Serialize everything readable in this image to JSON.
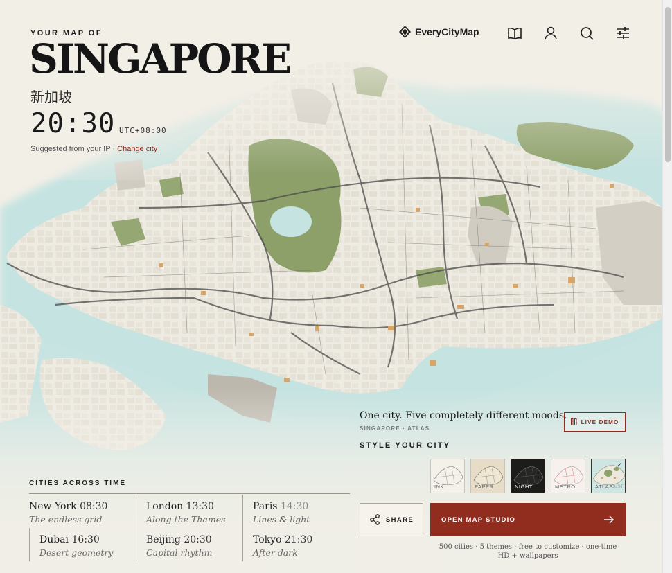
{
  "hero": {
    "eyebrow": "YOUR MAP OF",
    "city": "SINGAPORE",
    "native_name": "新加坡",
    "local_time": "20:30",
    "timezone": "UTC+08:00",
    "ip_note": "Suggested from your IP · ",
    "change_city": "Change city"
  },
  "nav": {
    "brand": "EveryCityMap",
    "icons": [
      "book-icon",
      "user-icon",
      "search-icon",
      "sliders-icon"
    ]
  },
  "cities": {
    "title": "CITIES ACROSS TIME",
    "items": [
      {
        "city": "New York",
        "time": "08:30",
        "tagline": "The endless grid",
        "dim": false
      },
      {
        "city": "London",
        "time": "13:30",
        "tagline": "Along the Thames",
        "dim": false
      },
      {
        "city": "Paris",
        "time": "14:30",
        "tagline": "Lines & light",
        "dim": true
      },
      {
        "city": "Dubai",
        "time": "16:30",
        "tagline": "Desert geometry",
        "dim": false
      },
      {
        "city": "Beijing",
        "time": "20:30",
        "tagline": "Capital rhythm",
        "dim": false
      },
      {
        "city": "Tokyo",
        "time": "21:30",
        "tagline": "After dark",
        "dim": false
      }
    ]
  },
  "style_card": {
    "headline": "One city. Five completely different moods.",
    "subline": "SINGAPORE · ATLAS",
    "live_demo": "LIVE DEMO",
    "style_heading": "STYLE YOUR CITY",
    "styles": [
      {
        "label": "INK",
        "selected": false
      },
      {
        "label": "PAPER",
        "selected": false
      },
      {
        "label": "NIGHT",
        "selected": false
      },
      {
        "label": "METRO",
        "selected": false
      },
      {
        "label": "ATLAS",
        "selected": true,
        "extra": "CUST"
      }
    ],
    "share": "SHARE",
    "cta": "OPEN MAP STUDIO",
    "footnote": "500 cities · 5 themes · free to customize · one-time HD + wallpapers"
  },
  "colors": {
    "accent": "#912d1f",
    "water": "#bfe0df",
    "land": "#eeebe2",
    "park": "#8da06a",
    "road": "#4a4a48"
  }
}
